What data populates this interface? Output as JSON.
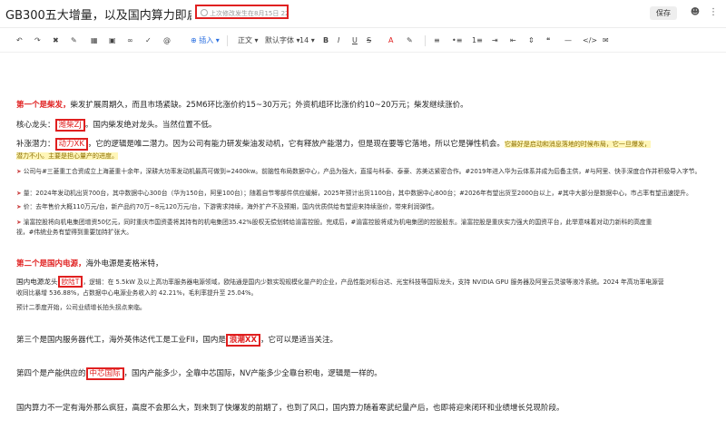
{
  "doc": {
    "title": "GB300五大增量，以及国内算力即启动的潜伏",
    "save_status": "上次修改发生在8月15日 22:20",
    "save_label": "保存"
  },
  "toolbar": {
    "insert": "插入",
    "paragraph": "正文",
    "font": "默认字体",
    "size": "14"
  },
  "content": {
    "p1_lead": "第一个是柴发，",
    "p1_rest": "柴发扩展周期久，而且市场紧缺。25M6环比涨价约15~30万元；外资机组环比涨价约10~20万元；柴发继续涨价。",
    "p2_a": "核心龙头：",
    "p2_box": "潍柴ZJ",
    "p2_b": "。国内柴发绝对龙头。当然位置不低。",
    "p3_a": "补涨潜力：",
    "p3_box": "动力XK",
    "p3_b": "，它的逻辑是唯二潜力。因为公司有能力研发柴油发动机，它有释放产能潜力，但是现在要等它落地，所以它是弹性机会。",
    "p3_hl1": "它最好是启动和消息落地的时候布局，它一旦爆发，",
    "p3_hl2": "潜力不小。主要是担心量产的进度。",
    "b1": "公司与#三菱重工合资成立上海菱重十余年，深耕大功率发动机最高可做到≈2400kw。前脑性布局数据中心，产品为强大，直接与科泰、泰豪、苏美达紧密合作。#2019年进入华为云体系并成为后备主供，#与阿里、快手深度合作并积极导入字节。",
    "b2": "量：2024年发动机出货700台，其中数据中心300台（华为150台，阿里100台）；随着自节零部件供应缓解，2025年预计出货1100台，其中数据中心800台；#2026年有望出货至2000台以上，#其中大部分是数据中心，市占率有望迅速提升。",
    "b3": "价：去年售价大概110万元/台，新产品约70万~8元120万元/台，下游需求持续，海外扩产不及预期，国内优质供给有望迎来持续涨价，带来利润弹性。",
    "b4a": "渝富控股将向机电集团增资50亿元，同时重庆市国资委将其持有的机电集团35.42%股权无偿划转给渝富控股。完成后，#渝富控股将成为机电集团的控股股东。渝富控股是重庆实力强大的国资平台，此举意味着对动力新科的高度重",
    "b4b": "视，#伟统业务有望得到重要加持扩张大。",
    "p4_lead": "第二个是国内电源，",
    "p4_rest": "海外电源是麦格米特，",
    "p5_a": "国内电源龙头",
    "p5_box": "欧陆T",
    "p5_b": "，逻辑：在 5.5kW 及以上高功率服务器电源领域，欧陆通是国内少数实现规模化量产的企业，产品性能对标台达、光宝科技等国际龙头，支持 NVIDIA GPU 服务器及阿里云灵骏等液冷系统。2024 年高功率电源营",
    "p5_c": "收同比暴增 536.88%，占数据中心电源业务收入的 42.21%，毛利率提升至 25.04%。",
    "p6": "预计二季度开始，公司业绩增长拍头拐点来临。",
    "p7_a": "第三个是国内服务器代工，海外英伟达代工是工业FII，国内是",
    "p7_box": "浪潮XX",
    "p7_b": "，它可以是适当关注。",
    "p8_a": "第四个是产能供应的",
    "p8_box": "中芯国际",
    "p8_b": "，国内产能多少，全靠中芯国际，NV产能多少全靠台积电，逻辑是一样的。",
    "p9": "国内算力不一定有海外那么疯狂，高度不会那么大，到来到了快爆发的前期了，也到了风口，国内算力随着寒武纪量产后，也即将迎来闭环和业绩增长兑现阶段。"
  }
}
